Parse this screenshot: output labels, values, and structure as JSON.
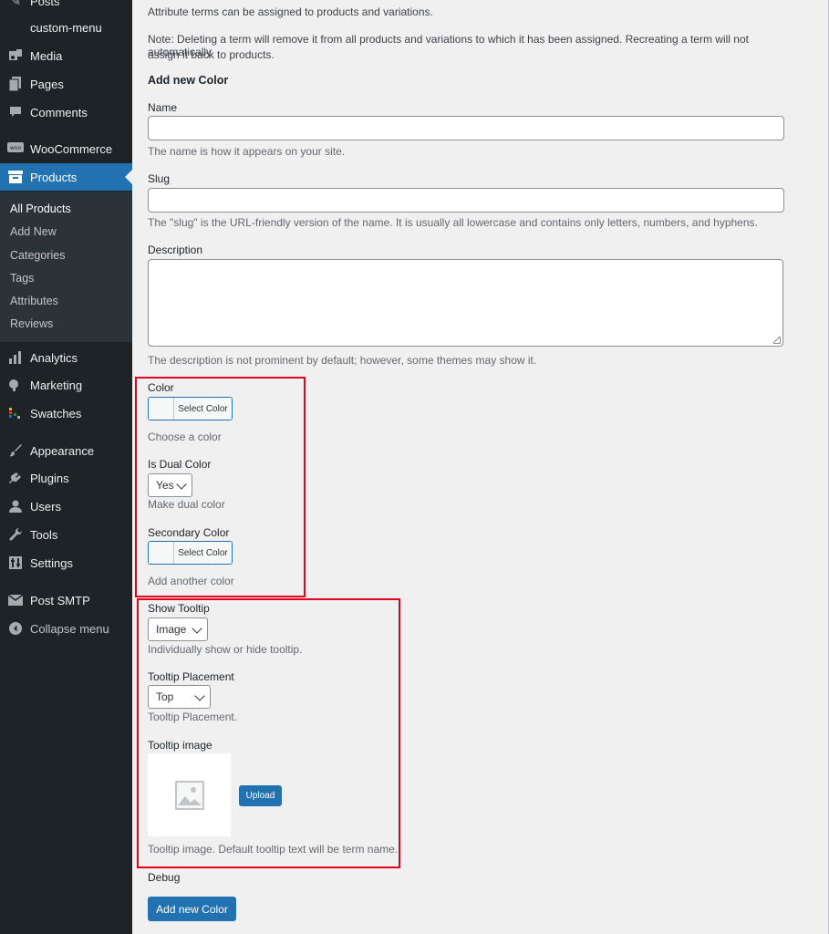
{
  "sidebar": {
    "items": [
      {
        "label": "Posts",
        "icon": "pin-icon"
      },
      {
        "label": "custom-menu",
        "icon": ""
      },
      {
        "label": "Media",
        "icon": "media-icon"
      },
      {
        "label": "Pages",
        "icon": "pages-icon"
      },
      {
        "label": "Comments",
        "icon": "comments-icon"
      },
      {
        "label": "WooCommerce",
        "icon": "woocommerce-icon"
      },
      {
        "label": "Products",
        "icon": "products-icon"
      },
      {
        "label": "Analytics",
        "icon": "analytics-icon"
      },
      {
        "label": "Marketing",
        "icon": "megaphone-icon"
      },
      {
        "label": "Swatches",
        "icon": "swatches-icon"
      },
      {
        "label": "Appearance",
        "icon": "brush-icon"
      },
      {
        "label": "Plugins",
        "icon": "plug-icon"
      },
      {
        "label": "Users",
        "icon": "user-icon"
      },
      {
        "label": "Tools",
        "icon": "wrench-icon"
      },
      {
        "label": "Settings",
        "icon": "settings-icon"
      },
      {
        "label": "Post SMTP",
        "icon": "mail-icon"
      },
      {
        "label": "Collapse menu",
        "icon": "collapse-icon"
      }
    ],
    "submenu": [
      "All Products",
      "Add New",
      "Categories",
      "Tags",
      "Attributes",
      "Reviews"
    ],
    "submenu_current": "All Products"
  },
  "main": {
    "intro": "Attribute terms can be assigned to products and variations.",
    "note_line1": "Note: Deleting a term will remove it from all products and variations to which it has been assigned. Recreating a term will not automatically",
    "note_line2": "assign it back to products.",
    "form_title": "Add new Color",
    "name": {
      "label": "Name",
      "value": "",
      "help": "The name is how it appears on your site."
    },
    "slug": {
      "label": "Slug",
      "value": "",
      "help": "The \"slug\" is the URL-friendly version of the name. It is usually all lowercase and contains only letters, numbers, and hyphens."
    },
    "description": {
      "label": "Description",
      "value": "",
      "help": "The description is not prominent by default; however, some themes may show it."
    },
    "color": {
      "label": "Color",
      "button": "Select Color",
      "help": "Choose a color"
    },
    "dual_color": {
      "label": "Is Dual Color",
      "value": "Yes",
      "help": "Make dual color"
    },
    "secondary_color": {
      "label": "Secondary Color",
      "button": "Select Color",
      "help": "Add another color"
    },
    "show_tooltip": {
      "label": "Show Tooltip",
      "value": "Image",
      "help": "Individually show or hide tooltip."
    },
    "tooltip_placement": {
      "label": "Tooltip Placement",
      "value": "Top",
      "help": "Tooltip Placement."
    },
    "tooltip_image": {
      "label": "Tooltip image",
      "upload": "Upload",
      "help": "Tooltip image. Default tooltip text will be term name."
    },
    "debug": "Debug",
    "submit": "Add new Color"
  },
  "colors": {
    "sidebar_bg": "#1d2327",
    "active": "#2271b1",
    "highlight_box": "#e3001b"
  }
}
